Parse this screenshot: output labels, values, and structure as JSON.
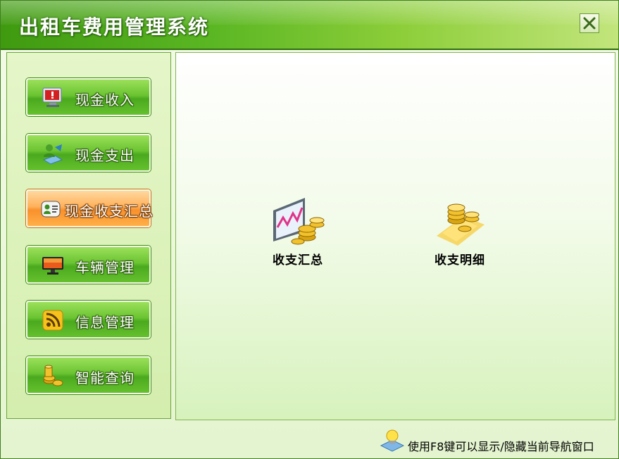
{
  "app": {
    "title": "出租车费用管理系统"
  },
  "sidebar": {
    "items": [
      {
        "label": "现金收入",
        "icon": "monitor-alert-icon",
        "active": false
      },
      {
        "label": "现金支出",
        "icon": "user-money-icon",
        "active": false
      },
      {
        "label": "现金收支汇总",
        "icon": "contact-card-icon",
        "active": true
      },
      {
        "label": "车辆管理",
        "icon": "monitor-icon",
        "active": false
      },
      {
        "label": "信息管理",
        "icon": "rss-icon",
        "active": false
      },
      {
        "label": "智能查询",
        "icon": "coins-icon",
        "active": false
      }
    ]
  },
  "main": {
    "features": [
      {
        "label": "收支汇总",
        "icon": "chart-coins-icon"
      },
      {
        "label": "收支明细",
        "icon": "gold-coins-icon"
      }
    ]
  },
  "status": {
    "hint": "使用F8键可以显示/隐藏当前导航窗口",
    "icon": "lightbulb-icon"
  },
  "colors": {
    "titlebar_start": "#3f9a10",
    "button_green": "#6bc431",
    "button_active_orange": "#f9902c",
    "panel_bg_bottom": "#d7f2bd"
  }
}
